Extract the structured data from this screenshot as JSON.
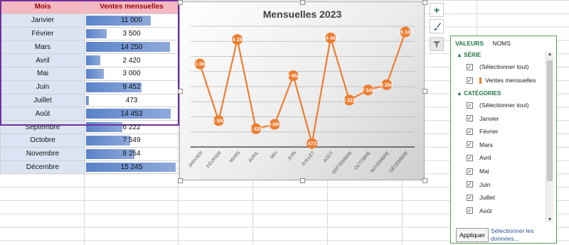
{
  "sheet": {
    "header_mois": "Mois",
    "header_ventes": "Ventes mensuelles",
    "rows": [
      {
        "mois": "Janvier",
        "valeur": "11 000"
      },
      {
        "mois": "Février",
        "valeur": "3 500"
      },
      {
        "mois": "Mars",
        "valeur": "14 250"
      },
      {
        "mois": "Avril",
        "valeur": "2 420"
      },
      {
        "mois": "Mai",
        "valeur": "3 000"
      },
      {
        "mois": "Juin",
        "valeur": "9 452"
      },
      {
        "mois": "Juillet",
        "valeur": "473"
      },
      {
        "mois": "Août",
        "valeur": "14 453"
      },
      {
        "mois": "Septembre",
        "valeur": "6 222"
      },
      {
        "mois": "Octobre",
        "valeur": "7 549"
      },
      {
        "mois": "Novembre",
        "valeur": "8 254"
      },
      {
        "mois": "Décembre",
        "valeur": "15 245"
      }
    ],
    "databar_color": "#5a83c8",
    "header_fill": "#f4b8c2"
  },
  "chart_data": {
    "type": "line",
    "title": "Mensuelles 2023",
    "categories": [
      "JANVIER",
      "FÉVRIER",
      "MARS",
      "AVRIL",
      "MAI",
      "JUIN",
      "JUILLET",
      "AOÛT",
      "SEPTEMBRE",
      "OCTOBRE",
      "NOVEMBRE",
      "DÉCEMBRE"
    ],
    "series": [
      {
        "name": "Ventes mensuelles",
        "values": [
          11000,
          3500,
          14250,
          2420,
          3000,
          9452,
          473,
          14453,
          6222,
          7549,
          8254,
          15245
        ],
        "labels": [
          "11 000",
          "3 500",
          "14 250",
          "2 420",
          "3 000",
          "9 452",
          "473",
          "14 453",
          "6 222",
          "7 549",
          "8 254",
          "15 245"
        ],
        "color": "#ed7d31"
      }
    ],
    "ylim": [
      0,
      16000
    ],
    "grid": true
  },
  "tools": {
    "add_icon": "plus-icon",
    "style_icon": "brush-icon",
    "filter_icon": "filter-icon"
  },
  "filter_pane": {
    "tab_valeurs": "VALEURS",
    "tab_noms": "NOMS",
    "section_serie": "SÉRIE",
    "serie_items": [
      "(Sélectionner tout)",
      "Ventes mensuelles"
    ],
    "section_categories": "CATÉGORIES",
    "category_items": [
      "(Sélectionner tout)",
      "Janvier",
      "Février",
      "Mars",
      "Avril",
      "Mai",
      "Juin",
      "Juillet",
      "Août"
    ],
    "apply_label": "Appliquer",
    "select_data_link": "Sélectionner les données..."
  }
}
